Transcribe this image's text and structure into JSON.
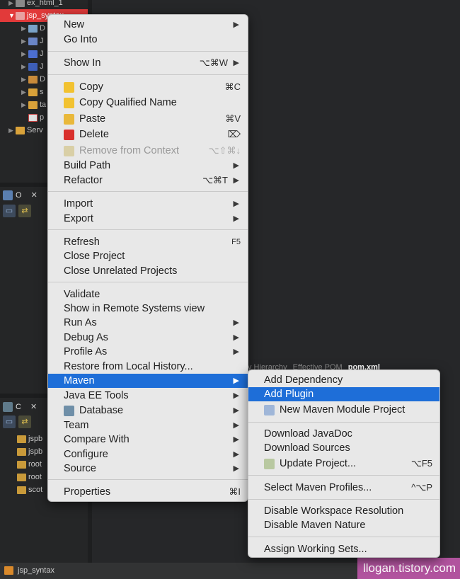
{
  "project_explorer": {
    "items": [
      {
        "label": "ex_html_1"
      },
      {
        "label": "jsp_syntax"
      },
      {
        "label": "D"
      },
      {
        "label": "J"
      },
      {
        "label": "J"
      },
      {
        "label": "J"
      },
      {
        "label": "D"
      },
      {
        "label": "s"
      },
      {
        "label": "ta"
      },
      {
        "label": "p"
      },
      {
        "label": "Serv"
      }
    ]
  },
  "outline_view": {
    "title": "O"
  },
  "console_view": {
    "title": "C",
    "items": [
      {
        "label": "jspb"
      },
      {
        "label": "jspb"
      },
      {
        "label": "root"
      },
      {
        "label": "root"
      },
      {
        "label": "scot"
      }
    ]
  },
  "editor": {
    "tabs": [
      "y Hierarchy",
      "Effective POM",
      "pom.xml"
    ]
  },
  "context_menu": {
    "items": {
      "new": "New",
      "go_into": "Go Into",
      "show_in": "Show In",
      "show_in_sc": "⌥⌘W",
      "copy": "Copy",
      "copy_sc": "⌘C",
      "copy_qualified": "Copy Qualified Name",
      "paste": "Paste",
      "paste_sc": "⌘V",
      "delete": "Delete",
      "delete_sc": "⌦",
      "remove_context": "Remove from Context",
      "remove_context_sc": "⌥⇧⌘↓",
      "build_path": "Build Path",
      "refactor": "Refactor",
      "refactor_sc": "⌥⌘T",
      "import": "Import",
      "export": "Export",
      "refresh": "Refresh",
      "refresh_sc": "F5",
      "close_project": "Close Project",
      "close_unrelated": "Close Unrelated Projects",
      "validate": "Validate",
      "show_remote": "Show in Remote Systems view",
      "run_as": "Run As",
      "debug_as": "Debug As",
      "profile_as": "Profile As",
      "restore_history": "Restore from Local History...",
      "maven": "Maven",
      "java_ee_tools": "Java EE Tools",
      "database": "Database",
      "team": "Team",
      "compare_with": "Compare With",
      "configure": "Configure",
      "source": "Source",
      "properties": "Properties",
      "properties_sc": "⌘I"
    }
  },
  "maven_submenu": {
    "items": {
      "add_dependency": "Add Dependency",
      "add_plugin": "Add Plugin",
      "new_module": "New Maven Module Project",
      "download_javadoc": "Download JavaDoc",
      "download_sources": "Download Sources",
      "update_project": "Update Project...",
      "update_project_sc": "⌥F5",
      "select_profiles": "Select Maven Profiles...",
      "select_profiles_sc": "^⌥P",
      "disable_workspace": "Disable Workspace Resolution",
      "disable_nature": "Disable Maven Nature",
      "assign_working_sets": "Assign Working Sets..."
    }
  },
  "status_bar": {
    "project": "jsp_syntax"
  },
  "watermark": "llogan.tistory.com",
  "colors": {
    "highlight": "#1e6ed8",
    "selection_red": "#e23a3a",
    "watermark_bg": "#b1539e"
  }
}
